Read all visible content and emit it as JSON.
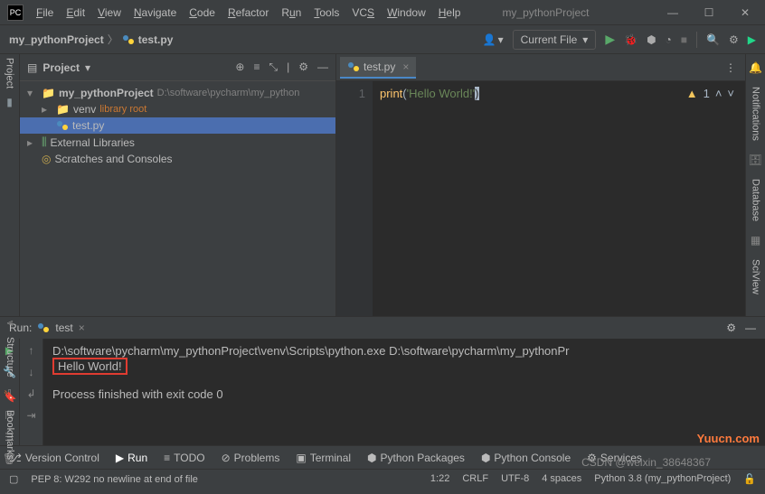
{
  "app": {
    "icon_label": "PC",
    "project_title": "my_pythonProject"
  },
  "menu": {
    "file": "File",
    "edit": "Edit",
    "view": "View",
    "navigate": "Navigate",
    "code": "Code",
    "refactor": "Refactor",
    "run": "Run",
    "tools": "Tools",
    "vcs": "VCS",
    "window": "Window",
    "help": "Help"
  },
  "breadcrumb": {
    "project": "my_pythonProject",
    "file": "test.py"
  },
  "navbar": {
    "config": "Current File"
  },
  "project_panel": {
    "title": "Project",
    "root": {
      "name": "my_pythonProject",
      "path": "D:\\software\\pycharm\\my_python"
    },
    "venv": {
      "name": "venv",
      "tag": "library root"
    },
    "file": "test.py",
    "ext_libs": "External Libraries",
    "scratches": "Scratches and Consoles"
  },
  "editor": {
    "tab": "test.py",
    "line_no": "1",
    "code": {
      "fn": "print",
      "lp": "(",
      "str": "'Hello World!'",
      "rp": ")"
    },
    "warning_count": "1"
  },
  "run_panel": {
    "label": "Run:",
    "config_name": "test",
    "cmd": "D:\\software\\pycharm\\my_pythonProject\\venv\\Scripts\\python.exe D:\\software\\pycharm\\my_pythonPr",
    "output": "Hello World!",
    "exit": "Process finished with exit code 0"
  },
  "side_labels": {
    "project": "Project",
    "structure": "Structure",
    "bookmarks": "Bookmarks",
    "notifications": "Notifications",
    "database": "Database",
    "sciview": "SciView"
  },
  "bottom_tabs": {
    "vcs": "Version Control",
    "run": "Run",
    "todo": "TODO",
    "problems": "Problems",
    "terminal": "Terminal",
    "pypkg": "Python Packages",
    "pyconsole": "Python Console",
    "services": "Services"
  },
  "status": {
    "msg": "PEP 8: W292 no newline at end of file",
    "pos": "1:22",
    "eol": "CRLF",
    "enc": "UTF-8",
    "indent": "4 spaces",
    "python": "Python 3.8 (my_pythonProject)"
  },
  "watermark": "Yuucn.com",
  "watermark2": "CSDN @weixin_38648367"
}
